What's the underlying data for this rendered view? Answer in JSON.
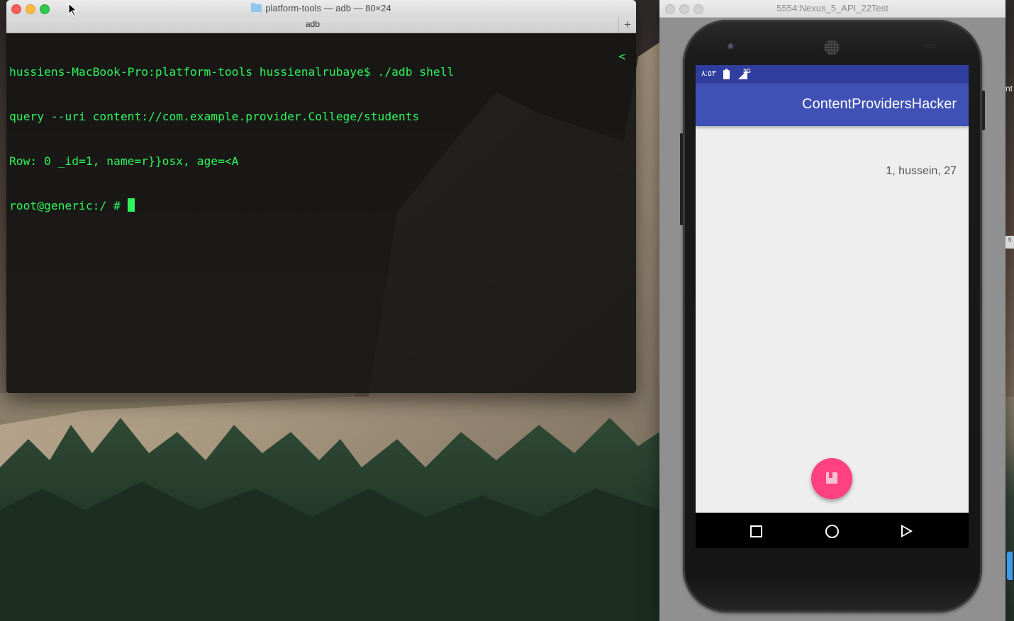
{
  "terminal": {
    "window_title": "platform-tools — adb — 80×24",
    "tab_label": "adb",
    "new_tab_symbol": "+",
    "lines": [
      "hussiens-MacBook-Pro:platform-tools hussienalrubaye$ ./adb shell",
      "query --uri content://com.example.provider.College/students",
      "Row: 0 _id=1, name=r}}osx, age=<A",
      "root@generic:/ # "
    ],
    "wrap_marker": "<",
    "text_color": "#2ff45a"
  },
  "emulator": {
    "window_title": "5554:Nexus_5_API_22Test",
    "status_bar": {
      "time": "٨:٥٣",
      "network": "3G"
    },
    "app_bar": {
      "title": "ContentProvidersHacker",
      "color": "#3f51b5"
    },
    "content": {
      "result_text": "1, hussein, 27"
    },
    "fab": {
      "color": "#ff4081",
      "icon": "bookmark-icon"
    },
    "nav_bar": {
      "buttons": [
        "recents-icon",
        "home-icon",
        "back-icon"
      ]
    }
  },
  "desktop": {
    "edge_text": "nt",
    "edge_tag": "s"
  }
}
